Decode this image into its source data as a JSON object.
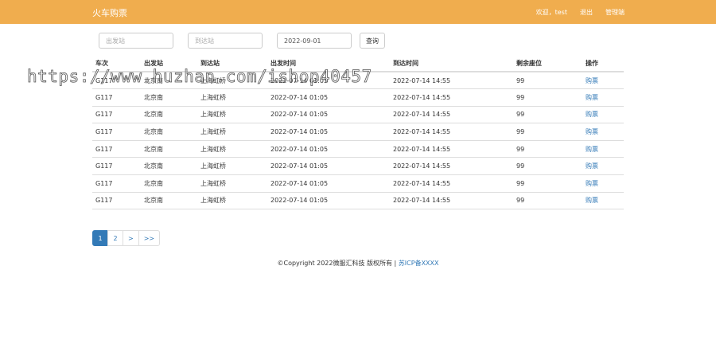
{
  "header": {
    "brand": "火车购票",
    "welcome": "欢迎，test",
    "logout": "退出",
    "admin": "管理端"
  },
  "search": {
    "from_placeholder": "出发站",
    "to_placeholder": "到达站",
    "date_value": "2022-09-01",
    "query_label": "查询"
  },
  "table": {
    "headers": [
      "车次",
      "出发站",
      "到达站",
      "出发时间",
      "到达时间",
      "剩余座位",
      "操作"
    ],
    "rows": [
      [
        "G117",
        "北京南",
        "上海虹桥",
        "2022-07-14 01:05",
        "2022-07-14 14:55",
        "99",
        "购票"
      ],
      [
        "G117",
        "北京南",
        "上海虹桥",
        "2022-07-14 01:05",
        "2022-07-14 14:55",
        "99",
        "购票"
      ],
      [
        "G117",
        "北京南",
        "上海虹桥",
        "2022-07-14 01:05",
        "2022-07-14 14:55",
        "99",
        "购票"
      ],
      [
        "G117",
        "北京南",
        "上海虹桥",
        "2022-07-14 01:05",
        "2022-07-14 14:55",
        "99",
        "购票"
      ],
      [
        "G117",
        "北京南",
        "上海虹桥",
        "2022-07-14 01:05",
        "2022-07-14 14:55",
        "99",
        "购票"
      ],
      [
        "G117",
        "北京南",
        "上海虹桥",
        "2022-07-14 01:05",
        "2022-07-14 14:55",
        "99",
        "购票"
      ],
      [
        "G117",
        "北京南",
        "上海虹桥",
        "2022-07-14 01:05",
        "2022-07-14 14:55",
        "99",
        "购票"
      ],
      [
        "G117",
        "北京南",
        "上海虹桥",
        "2022-07-14 01:05",
        "2022-07-14 14:55",
        "99",
        "购票"
      ]
    ]
  },
  "pagination": {
    "pages": [
      "1",
      "2",
      ">",
      ">>"
    ],
    "active": "1"
  },
  "footer": {
    "copyright": "©Copyright 2022微服汇科技 版权所有 | ",
    "icp": "苏ICP备XXXX"
  },
  "watermark": "https://www.huzhan.com/ishop40457",
  "colors": {
    "navbar": "#f0ad4e",
    "link": "#337ab7",
    "active_page": "#337ab7"
  }
}
